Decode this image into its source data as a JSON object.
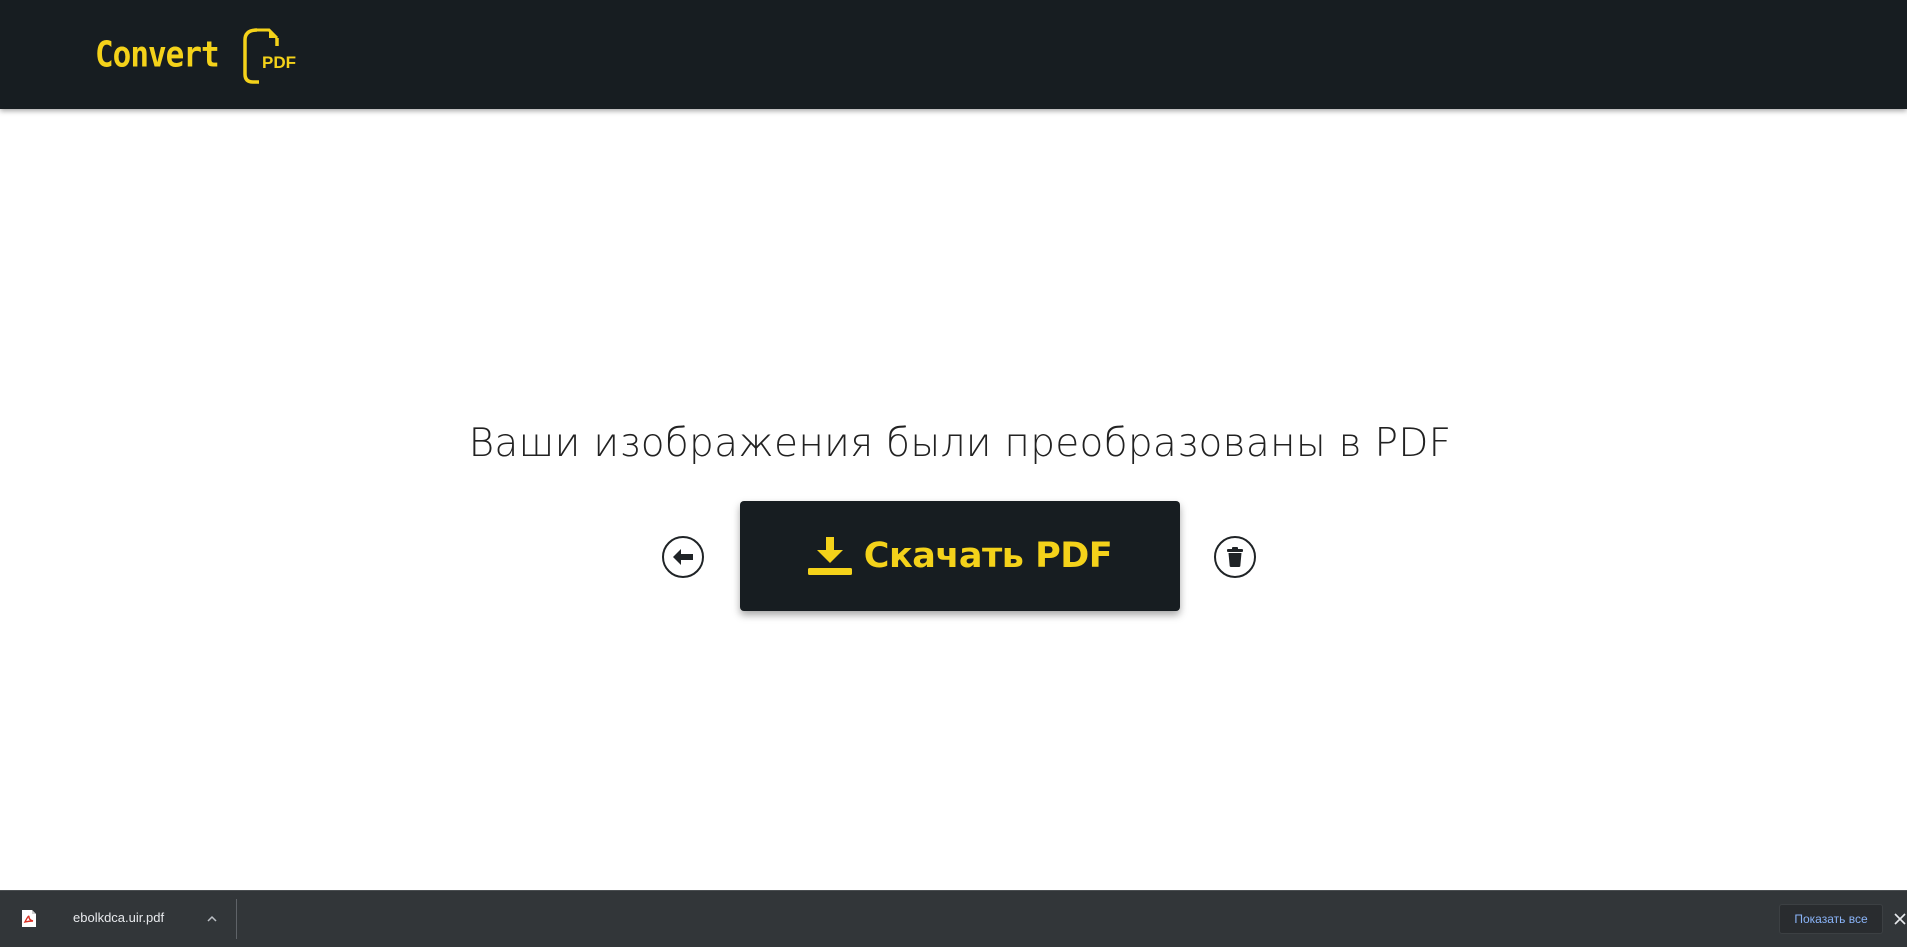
{
  "header": {
    "logo_text": "Convert",
    "logo_icon_text": "PDF"
  },
  "main": {
    "headline": "Ваши изображения были преобразованы в PDF",
    "download_label": "Скачать PDF",
    "back_icon": "arrow-left-icon",
    "delete_icon": "trash-icon",
    "download_icon": "download-icon"
  },
  "downloads_bar": {
    "file_name": "ebolkdca.uir.pdf",
    "file_icon": "pdf-file-icon",
    "show_all_label": "Показать все",
    "close_icon": "close-icon"
  },
  "colors": {
    "brand_yellow": "#f4d21a",
    "header_bg": "#171d21",
    "downloads_bar_bg": "#323639",
    "link_blue": "#8ab4f8"
  }
}
